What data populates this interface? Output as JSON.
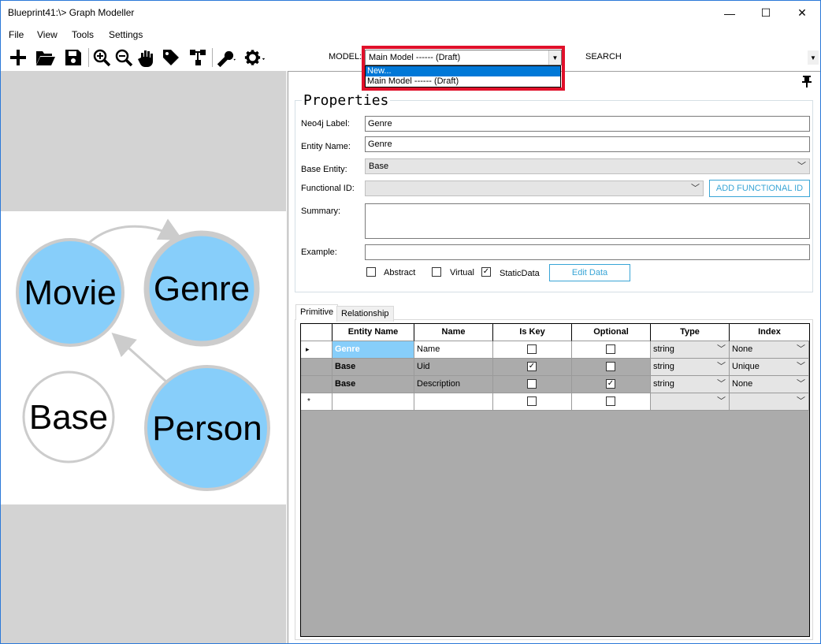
{
  "window": {
    "title": "Blueprint41:\\> Graph Modeller",
    "min_glyph": "—",
    "max_glyph": "☐",
    "close_glyph": "✕"
  },
  "menu": [
    "File",
    "View",
    "Tools",
    "Settings"
  ],
  "toolbar": {
    "icons": [
      "add-icon",
      "open-folder-icon",
      "save-icon",
      "zoom-in-icon",
      "zoom-out-icon",
      "pan-hand-icon",
      "tag-icon",
      "tree-icon",
      "wrench-icon",
      "gear-icon"
    ],
    "model_label": "MODEL:",
    "model_value": "Main Model ------ (Draft)",
    "model_options": [
      "New...",
      "Main Model ------ (Draft)"
    ],
    "search_label": "SEARCH"
  },
  "graph": {
    "nodes": [
      {
        "label": "Movie",
        "fill": "#87cefa"
      },
      {
        "label": "Genre",
        "fill": "#87cefa"
      },
      {
        "label": "Base",
        "fill": "#ffffff"
      },
      {
        "label": "Person",
        "fill": "#87cefa"
      }
    ]
  },
  "properties": {
    "title": "Properties",
    "neo4j_label_label": "Neo4j Label:",
    "neo4j_label_value": "Genre",
    "entity_name_label": "Entity Name:",
    "entity_name_value": "Genre",
    "base_entity_label": "Base Entity:",
    "base_entity_value": "Base",
    "functional_id_label": "Functional ID:",
    "functional_id_value": "",
    "add_functional_id": "ADD FUNCTIONAL ID",
    "summary_label": "Summary:",
    "summary_value": "",
    "example_label": "Example:",
    "example_value": "",
    "abstract_label": "Abstract",
    "abstract_checked": false,
    "virtual_label": "Virtual",
    "virtual_checked": false,
    "staticdata_label": "StaticData",
    "staticdata_checked": true,
    "edit_data": "Edit Data"
  },
  "tabs": [
    "Primitive",
    "Relationship"
  ],
  "grid": {
    "headers": [
      "Entity Name",
      "Name",
      "Is Key",
      "Optional",
      "Type",
      "Index"
    ],
    "rows": [
      {
        "entity": "Genre",
        "name": "Name",
        "is_key": false,
        "optional": false,
        "type": "string",
        "index": "None",
        "current": true
      },
      {
        "entity": "Base",
        "name": "Uid",
        "is_key": true,
        "optional": false,
        "type": "string",
        "index": "Unique",
        "current": false
      },
      {
        "entity": "Base",
        "name": "Description",
        "is_key": false,
        "optional": true,
        "type": "string",
        "index": "None",
        "current": false
      }
    ],
    "new_row_marker": "*",
    "current_row_marker": "▸"
  },
  "colors": {
    "accent": "#39a5d6",
    "selection": "#0078d7",
    "highlight_border": "#e0102a",
    "node_fill": "#87cefa"
  }
}
